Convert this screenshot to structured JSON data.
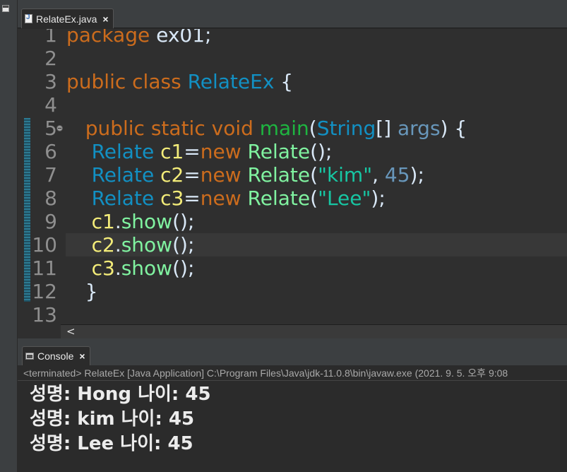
{
  "editor_tab": {
    "title": "RelateEx.java",
    "close": "×",
    "icon": "java-file-icon"
  },
  "editor": {
    "current_line": 10,
    "lines": [
      {
        "n": "1",
        "tokens": [
          {
            "t": "package ",
            "c": "kw"
          },
          {
            "t": "ex01;",
            "c": "pl"
          }
        ]
      },
      {
        "n": "2",
        "tokens": []
      },
      {
        "n": "3",
        "tokens": [
          {
            "t": "public class ",
            "c": "kw"
          },
          {
            "t": "RelateEx",
            "c": "ty"
          },
          {
            "t": " {",
            "c": "pl"
          }
        ]
      },
      {
        "n": "4",
        "tokens": []
      },
      {
        "n": "5",
        "tokens": [
          {
            "t": "   public static void ",
            "c": "kw"
          },
          {
            "t": "main",
            "c": "mtg"
          },
          {
            "t": "(",
            "c": "pl"
          },
          {
            "t": "String",
            "c": "ty"
          },
          {
            "t": "[] ",
            "c": "pl"
          },
          {
            "t": "args",
            "c": "nm"
          },
          {
            "t": ") {",
            "c": "pl"
          }
        ]
      },
      {
        "n": "6",
        "tokens": [
          {
            "t": "    Relate ",
            "c": "ty"
          },
          {
            "t": "c1",
            "c": "vr"
          },
          {
            "t": "=",
            "c": "pl"
          },
          {
            "t": "new ",
            "c": "kw"
          },
          {
            "t": "Relate",
            "c": "mt"
          },
          {
            "t": "();",
            "c": "pl"
          }
        ]
      },
      {
        "n": "7",
        "tokens": [
          {
            "t": "    Relate ",
            "c": "ty"
          },
          {
            "t": "c2",
            "c": "vr"
          },
          {
            "t": "=",
            "c": "pl"
          },
          {
            "t": "new ",
            "c": "kw"
          },
          {
            "t": "Relate",
            "c": "mt"
          },
          {
            "t": "(",
            "c": "pl"
          },
          {
            "t": "\"kim\"",
            "c": "st"
          },
          {
            "t": ", ",
            "c": "pl"
          },
          {
            "t": "45",
            "c": "nm"
          },
          {
            "t": ");",
            "c": "pl"
          }
        ]
      },
      {
        "n": "8",
        "tokens": [
          {
            "t": "    Relate ",
            "c": "ty"
          },
          {
            "t": "c3",
            "c": "vr"
          },
          {
            "t": "=",
            "c": "pl"
          },
          {
            "t": "new ",
            "c": "kw"
          },
          {
            "t": "Relate",
            "c": "mt"
          },
          {
            "t": "(",
            "c": "pl"
          },
          {
            "t": "\"Lee\"",
            "c": "st"
          },
          {
            "t": ");",
            "c": "pl"
          }
        ]
      },
      {
        "n": "9",
        "tokens": [
          {
            "t": "    c1",
            "c": "vr"
          },
          {
            "t": ".",
            "c": "pl"
          },
          {
            "t": "show",
            "c": "mt"
          },
          {
            "t": "();",
            "c": "pl"
          }
        ]
      },
      {
        "n": "10",
        "tokens": [
          {
            "t": "    c2",
            "c": "vr"
          },
          {
            "t": ".",
            "c": "pl"
          },
          {
            "t": "show",
            "c": "mt"
          },
          {
            "t": "();",
            "c": "pl"
          }
        ]
      },
      {
        "n": "11",
        "tokens": [
          {
            "t": "    c3",
            "c": "vr"
          },
          {
            "t": ".",
            "c": "pl"
          },
          {
            "t": "show",
            "c": "mt"
          },
          {
            "t": "();",
            "c": "pl"
          }
        ]
      },
      {
        "n": "12",
        "tokens": [
          {
            "t": "   }",
            "c": "pl"
          }
        ]
      },
      {
        "n": "13",
        "tokens": []
      }
    ]
  },
  "scrollbar": {
    "left_arrow": "<"
  },
  "console_tab": {
    "title": "Console",
    "close": "×",
    "icon": "console-icon"
  },
  "console": {
    "status": "<terminated> RelateEx [Java Application] C:\\Program Files\\Java\\jdk-11.0.8\\bin\\javaw.exe  (2021. 9. 5. 오후 9:08",
    "output": [
      "성명: Hong 나이: 45",
      "성명: kim 나이: 45",
      "성명: Lee 나이: 45"
    ]
  },
  "colors": {
    "keyword": "#cc6c1d",
    "type": "#1290c3",
    "method": "#80f2a0",
    "variable": "#f3ec79",
    "string": "#17c6a3",
    "number": "#6897bb",
    "background": "#2f2f2f"
  }
}
